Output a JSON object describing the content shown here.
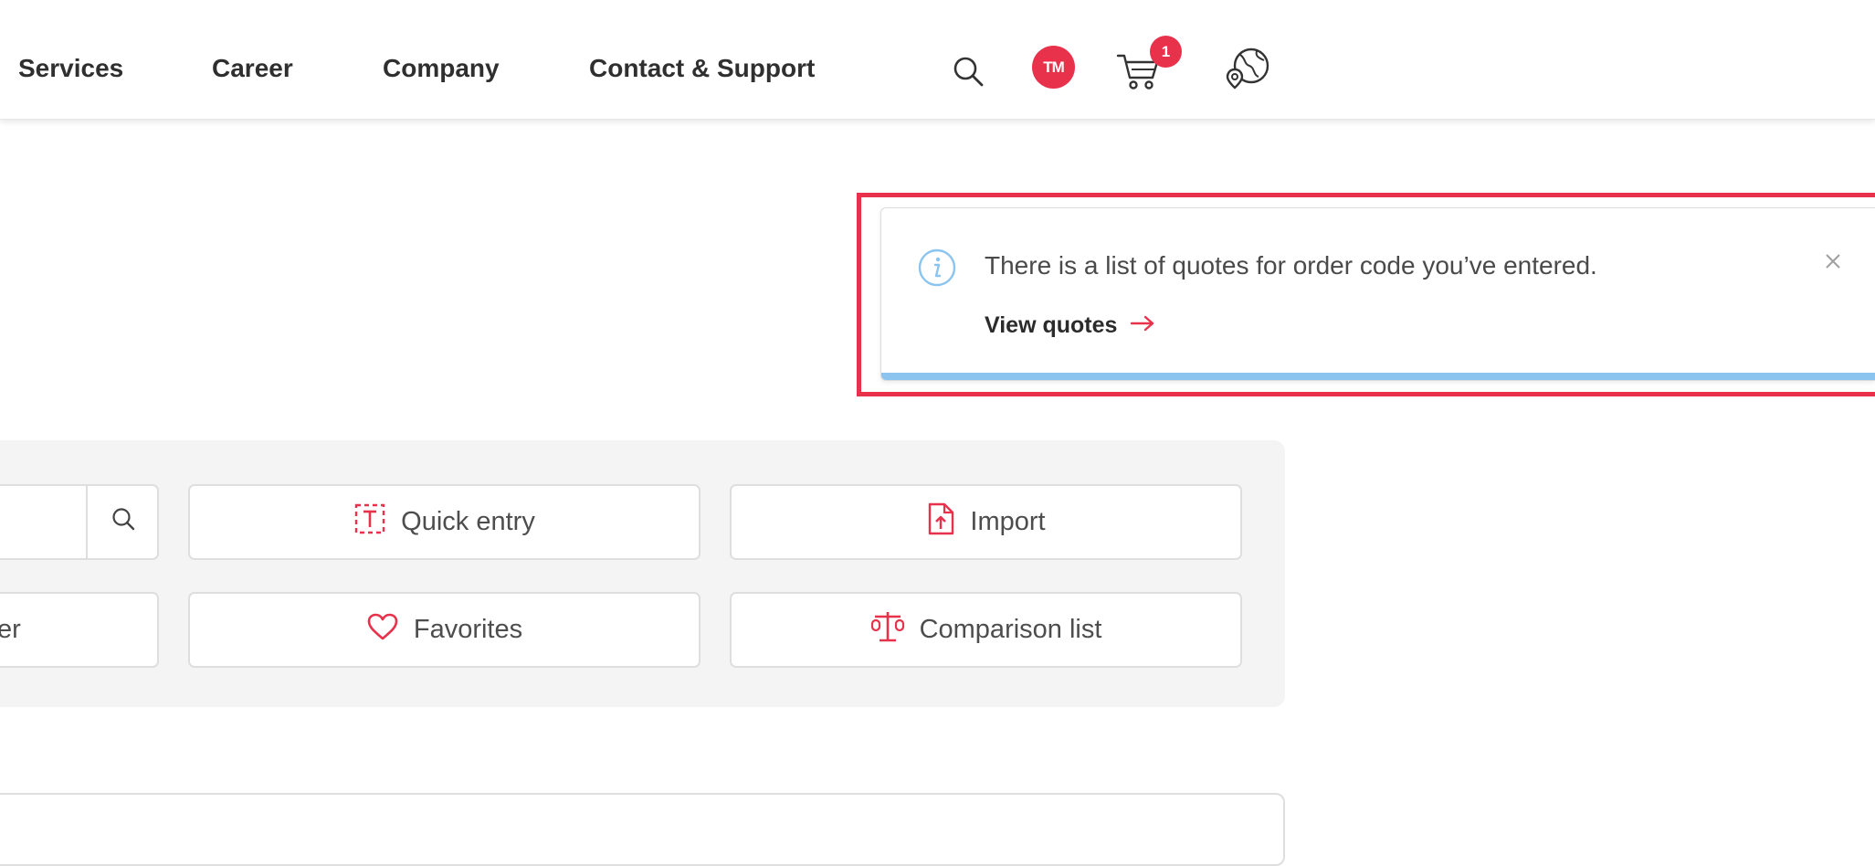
{
  "nav": {
    "items": [
      {
        "label": "Services"
      },
      {
        "label": "Career"
      },
      {
        "label": "Company"
      },
      {
        "label": "Contact & Support"
      }
    ],
    "avatar_initials": "TM",
    "cart_count": "1"
  },
  "notification": {
    "message": "There is a list of quotes for order code you’ve entered.",
    "link_label": "View quotes"
  },
  "actions": {
    "quick_entry": "Quick entry",
    "import": "Import",
    "partial_button_text": "er",
    "favorites": "Favorites",
    "comparison_list": "Comparison list"
  },
  "colors": {
    "brand_red": "#e8324c",
    "info_blue": "#8cc4f0",
    "panel_bg": "#f4f4f4"
  },
  "icons": {
    "search": "search-icon",
    "cart": "cart-icon",
    "location": "location-globe-icon",
    "info": "info-icon",
    "close": "close-icon",
    "arrow": "arrow-right-icon",
    "quick_entry": "text-entry-icon",
    "import": "file-upload-icon",
    "favorites": "heart-icon",
    "comparison": "scale-icon"
  }
}
